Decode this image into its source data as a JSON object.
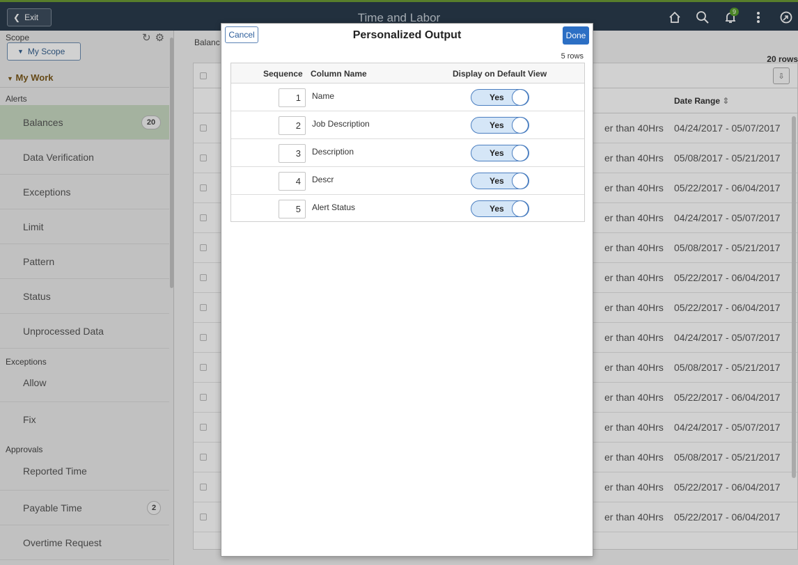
{
  "header": {
    "exit_label": "Exit",
    "title": "Time and Labor",
    "notification_count": "9"
  },
  "sidebar": {
    "scope_label": "Scope",
    "scope_button": "My Scope",
    "my_work": "My Work",
    "alerts_label": "Alerts",
    "alerts_items": [
      {
        "label": "Balances",
        "badge": "20"
      },
      {
        "label": "Data Verification"
      },
      {
        "label": "Exceptions"
      },
      {
        "label": "Limit"
      },
      {
        "label": "Pattern"
      },
      {
        "label": "Status"
      },
      {
        "label": "Unprocessed Data"
      }
    ],
    "exceptions_label": "Exceptions",
    "exceptions_items": [
      {
        "label": "Allow"
      },
      {
        "label": "Fix"
      }
    ],
    "approvals_label": "Approvals",
    "approvals_items": [
      {
        "label": "Reported Time"
      },
      {
        "label": "Payable Time",
        "badge": "2"
      },
      {
        "label": "Overtime Request"
      }
    ]
  },
  "main": {
    "breadcrumb": "Balanc",
    "rows_count": "20 rows",
    "date_range_header": "Date Range",
    "rows": [
      {
        "alert": "er than 40Hrs",
        "date": "04/24/2017 - 05/07/2017"
      },
      {
        "alert": "er than 40Hrs",
        "date": "05/08/2017 - 05/21/2017"
      },
      {
        "alert": "er than 40Hrs",
        "date": "05/22/2017 - 06/04/2017"
      },
      {
        "alert": "er than 40Hrs",
        "date": "04/24/2017 - 05/07/2017"
      },
      {
        "alert": "er than 40Hrs",
        "date": "05/08/2017 - 05/21/2017"
      },
      {
        "alert": "er than 40Hrs",
        "date": "05/22/2017 - 06/04/2017"
      },
      {
        "alert": "er than 40Hrs",
        "date": "05/22/2017 - 06/04/2017"
      },
      {
        "alert": "er than 40Hrs",
        "date": "04/24/2017 - 05/07/2017"
      },
      {
        "alert": "er than 40Hrs",
        "date": "05/08/2017 - 05/21/2017"
      },
      {
        "alert": "er than 40Hrs",
        "date": "05/22/2017 - 06/04/2017"
      },
      {
        "alert": "er than 40Hrs",
        "date": "04/24/2017 - 05/07/2017"
      },
      {
        "alert": "er than 40Hrs",
        "date": "05/08/2017 - 05/21/2017"
      },
      {
        "alert": "er than 40Hrs",
        "date": "05/22/2017 - 06/04/2017"
      },
      {
        "alert": "er than 40Hrs",
        "date": "05/22/2017 - 06/04/2017"
      }
    ]
  },
  "modal": {
    "cancel": "Cancel",
    "title": "Personalized Output",
    "done": "Done",
    "rows_count": "5 rows",
    "col_sequence": "Sequence",
    "col_name": "Column Name",
    "col_display": "Display on Default View",
    "rows": [
      {
        "seq": "1",
        "name": "Name",
        "display": "Yes"
      },
      {
        "seq": "2",
        "name": "Job Description",
        "display": "Yes"
      },
      {
        "seq": "3",
        "name": "Description",
        "display": "Yes"
      },
      {
        "seq": "4",
        "name": "Descr",
        "display": "Yes"
      },
      {
        "seq": "5",
        "name": "Alert Status",
        "display": "Yes"
      }
    ]
  },
  "colors": {
    "header_bg": "#2a3b4c",
    "accent_blue": "#2c6fc4",
    "active_nav": "#c9dac3",
    "toggle_bg": "#d5e6f7"
  }
}
